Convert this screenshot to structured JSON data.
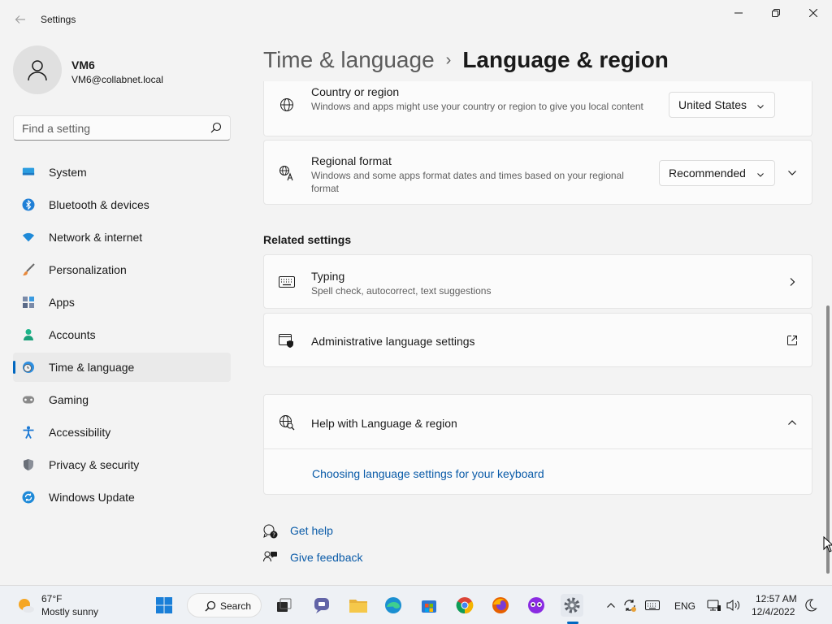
{
  "window": {
    "app_title": "Settings"
  },
  "profile": {
    "name": "VM6",
    "email": "VM6@collabnet.local"
  },
  "search": {
    "placeholder": "Find a setting"
  },
  "nav": {
    "items": [
      {
        "label": "System",
        "icon": "monitor-icon"
      },
      {
        "label": "Bluetooth & devices",
        "icon": "bluetooth-icon"
      },
      {
        "label": "Network & internet",
        "icon": "wifi-icon"
      },
      {
        "label": "Personalization",
        "icon": "brush-icon"
      },
      {
        "label": "Apps",
        "icon": "apps-icon"
      },
      {
        "label": "Accounts",
        "icon": "person-icon"
      },
      {
        "label": "Time & language",
        "icon": "clock-globe-icon",
        "active": true
      },
      {
        "label": "Gaming",
        "icon": "gamepad-icon"
      },
      {
        "label": "Accessibility",
        "icon": "accessibility-icon"
      },
      {
        "label": "Privacy & security",
        "icon": "shield-icon"
      },
      {
        "label": "Windows Update",
        "icon": "update-icon"
      }
    ]
  },
  "header": {
    "parent": "Time & language",
    "separator": "›",
    "current": "Language & region"
  },
  "cards": {
    "country": {
      "title": "Country or region",
      "desc": "Windows and apps might use your country or region to give you local content",
      "value": "United States"
    },
    "regional_format": {
      "title": "Regional format",
      "desc": "Windows and some apps format dates and times based on your regional format",
      "value": "Recommended"
    }
  },
  "related": {
    "title": "Related settings",
    "typing": {
      "title": "Typing",
      "desc": "Spell check, autocorrect, text suggestions"
    },
    "admin": {
      "title": "Administrative language settings"
    }
  },
  "help": {
    "title": "Help with Language & region",
    "link": "Choosing language settings for your keyboard"
  },
  "footer_links": {
    "get_help": "Get help",
    "give_feedback": "Give feedback"
  },
  "taskbar": {
    "weather_temp": "67°F",
    "weather_condition": "Mostly sunny",
    "search_label": "Search",
    "language": "ENG",
    "time": "12:57 AM",
    "date": "12/4/2022"
  },
  "colors": {
    "accent": "#0067c0",
    "link": "#0a5ba8"
  }
}
